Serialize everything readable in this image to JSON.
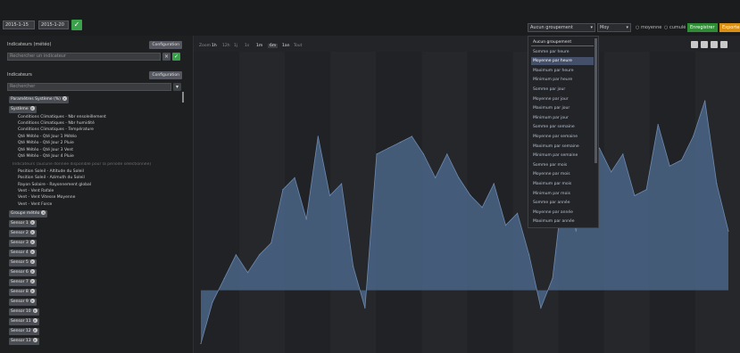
{
  "topbar": {
    "start_date": "2015-1-15",
    "end_date": "2015-1-20",
    "ok_icon": "check-icon",
    "grouping_select": "Aucun groupement",
    "agg_select": "Moy",
    "label_moyenne": "moyenne",
    "label_cumule": "cumulé",
    "save_button": "Enregistrer",
    "export_button": "Exporter"
  },
  "sidebar": {
    "section1_title": "Indicateurs (météo)",
    "section1_config": "Configuration",
    "search_placeholder": "Rechercher un indicateur",
    "section2_title": "Indicateurs",
    "section2_config": "Configuration",
    "filter_placeholder": "Rechercher",
    "tag1": "Paramètres Système (%)",
    "tag2": "Système",
    "items": [
      "Conditions Climatiques - Nbr ensoleillement",
      "Conditions Climatiques - Nbr humidité",
      "Conditions Climatiques - Température",
      "Qté Météo - Qté Jour 1 Météo",
      "Qté Météo - Qté Jour 2 Pluie",
      "Qté Météo - Qté Jour 3 Vent",
      "Qté Météo - Qté Jour 4 Pluie"
    ],
    "dim_item": "Indicateurs (aucune donnée disponible pour la période sélectionnée)",
    "items2": [
      "Position Soleil - Altitude du Soleil",
      "Position Soleil - Azimuth du Soleil",
      "Rayon Solaire - Rayonnement global",
      "Vent - Vent Rafale",
      "Vent - Vent Vitesse Moyenne",
      "Vent - Vent Force"
    ],
    "tag3": "Groupe météo",
    "sensors": [
      "Sensor 1",
      "Sensor 2",
      "Sensor 3",
      "Sensor 4",
      "Sensor 5",
      "Sensor 6",
      "Sensor 7",
      "Sensor 8",
      "Sensor 9",
      "Sensor 10",
      "Sensor 11",
      "Sensor 12",
      "Sensor 13"
    ]
  },
  "chart_toolbar": {
    "zoom": "Zoom",
    "options": [
      "1h",
      "12h",
      "1j",
      "1s",
      "1m",
      "6m",
      "1an",
      "Tout"
    ]
  },
  "dropdown": {
    "options": [
      "Aucun groupement",
      "Somme par heure",
      "Moyenne par heure",
      "Maximum par heure",
      "Minimum par heure",
      "Somme par jour",
      "Moyenne par jour",
      "Maximum par jour",
      "Minimum par jour",
      "Somme par semaine",
      "Moyenne par semaine",
      "Maximum par semaine",
      "Minimum par semaine",
      "Somme par mois",
      "Moyenne par mois",
      "Maximum par mois",
      "Minimum par mois",
      "Somme par année",
      "Moyenne par année",
      "Maximum par année"
    ],
    "selected_index": 2
  },
  "chart_data": {
    "type": "area",
    "color": "#4a6587",
    "baseline": 0,
    "ylim": [
      -1,
      4
    ],
    "x": [
      0,
      1,
      2,
      3,
      4,
      5,
      6,
      7,
      8,
      9,
      10,
      11,
      12,
      13,
      14,
      15,
      16,
      17,
      18,
      19,
      20,
      21,
      22,
      23,
      24,
      25,
      26,
      27,
      28,
      29,
      30,
      31,
      32,
      33,
      34,
      35,
      36,
      37,
      38,
      39,
      40,
      41,
      42,
      43,
      44,
      45
    ],
    "values": [
      -0.9,
      -0.2,
      0.2,
      0.6,
      0.3,
      0.6,
      0.8,
      1.7,
      1.9,
      1.2,
      2.6,
      1.6,
      1.8,
      0.4,
      -0.3,
      2.3,
      2.4,
      2.5,
      2.6,
      2.3,
      1.9,
      2.3,
      1.9,
      1.6,
      1.4,
      1.8,
      1.1,
      1.3,
      0.6,
      -0.3,
      0.2,
      1.9,
      1.0,
      2.2,
      2.4,
      2.0,
      2.3,
      1.6,
      1.7,
      2.8,
      2.1,
      2.2,
      2.6,
      3.2,
      1.8,
      1.0
    ]
  }
}
